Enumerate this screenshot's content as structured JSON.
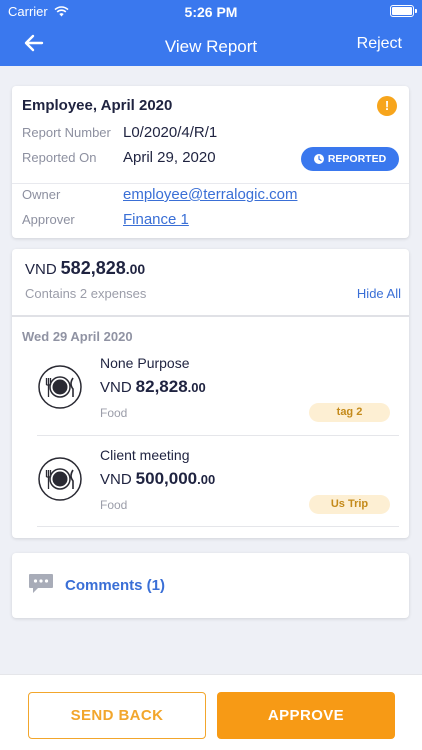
{
  "status_bar": {
    "carrier": "Carrier",
    "time": "5:26 PM"
  },
  "navbar": {
    "title": "View Report",
    "reject_label": "Reject"
  },
  "report": {
    "title": "Employee, April 2020",
    "number_label": "Report Number",
    "number": "L0/2020/4/R/1",
    "reported_on_label": "Reported On",
    "reported_on": "April 29, 2020",
    "status": "REPORTED",
    "owner_label": "Owner",
    "owner": "employee@terralogic.com",
    "approver_label": "Approver",
    "approver": "Finance 1"
  },
  "summary": {
    "currency": "VND",
    "total_int": "582,828",
    "total_dec": ".00",
    "contains": "Contains 2 expenses",
    "hide_all": "Hide All"
  },
  "date_header": "Wed 29 April 2020",
  "expenses": [
    {
      "name": "None Purpose",
      "currency": "VND",
      "amount_int": "82,828",
      "amount_dec": ".00",
      "category": "Food",
      "tag": "tag 2",
      "icon": "plate-icon"
    },
    {
      "name": "Client meeting",
      "currency": "VND",
      "amount_int": "500,000",
      "amount_dec": ".00",
      "category": "Food",
      "tag": "Us Trip",
      "icon": "plate-icon"
    }
  ],
  "comments_label": "Comments (1)",
  "actions": {
    "send_back": "SEND BACK",
    "approve": "APPROVE"
  },
  "colors": {
    "primary": "#3a78ee",
    "accent": "#f79a15",
    "link": "#3a6fd6",
    "warning": "#f7a51c",
    "tag_bg": "#fdefd3"
  }
}
